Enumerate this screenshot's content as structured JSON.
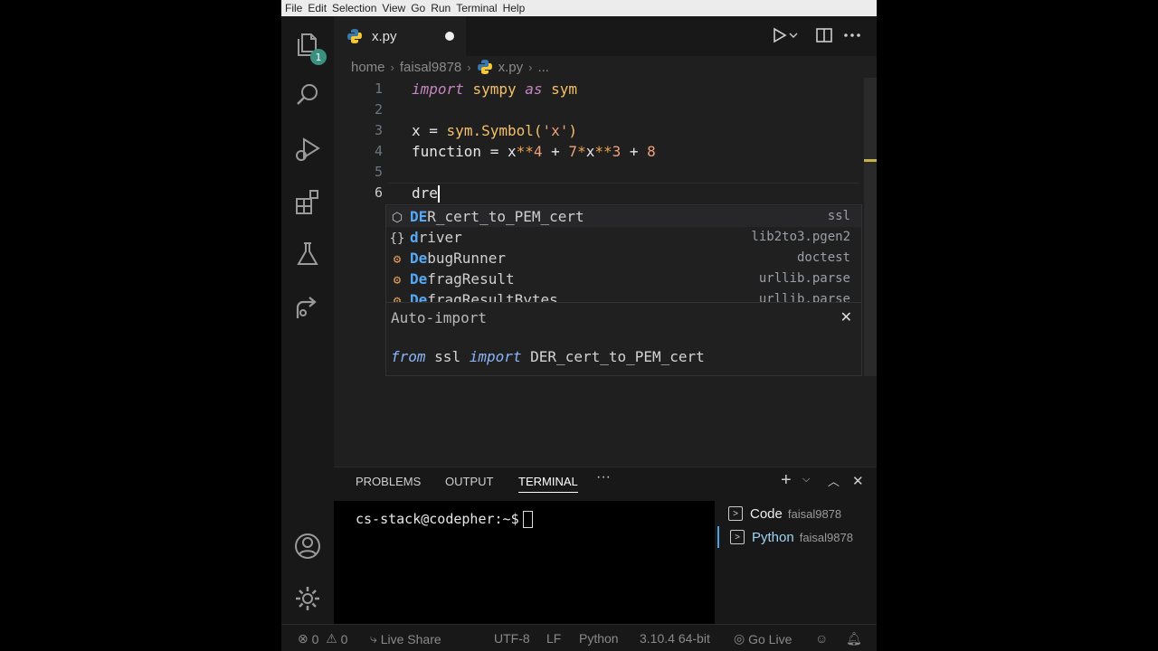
{
  "menu": [
    "File",
    "Edit",
    "Selection",
    "View",
    "Go",
    "Run",
    "Terminal",
    "Help"
  ],
  "activity": {
    "badge_count": "1"
  },
  "tab": {
    "filename": "x.py"
  },
  "breadcrumb": {
    "parts": [
      "home",
      "faisal9878",
      "x.py",
      "..."
    ]
  },
  "editor": {
    "line_numbers": [
      "1",
      "2",
      "3",
      "4",
      "5",
      "6"
    ],
    "line1": {
      "kw_import": "import",
      "module": "sympy",
      "kw_as": "as",
      "alias": "sym"
    },
    "line3": {
      "var": "x",
      "eq": " = ",
      "call": "sym.Symbol(",
      "str": "'x'",
      "close": ")"
    },
    "line4": {
      "var": "function",
      "eq": " = ",
      "a": "x",
      "op1": "**",
      "n1": "4",
      "p1": " + ",
      "n2": "7",
      "op2": "*",
      "b": "x",
      "op3": "**",
      "n3": "3",
      "p2": " + ",
      "n4": "8"
    },
    "line6": {
      "typed": "dre"
    }
  },
  "suggestions": [
    {
      "icon": "cube-icon",
      "match": "DE",
      "rest": "R_cert_to_PEM_cert",
      "detail": "ssl"
    },
    {
      "icon": "braces-icon",
      "match": "d",
      "rest": "river",
      "detail": "lib2to3.pgen2"
    },
    {
      "icon": "class-icon",
      "match": "De",
      "rest": "bugRunner",
      "detail": "doctest"
    },
    {
      "icon": "class-icon",
      "match": "De",
      "rest": "fragResult",
      "detail": "urllib.parse"
    },
    {
      "icon": "class-icon",
      "match": "De",
      "rest": "fragResultBytes",
      "detail": "urllib.parse"
    }
  ],
  "auto_import": {
    "title": "Auto-import",
    "kw_from": "from",
    "module": "ssl",
    "kw_import": "import",
    "name": "DER_cert_to_PEM_cert"
  },
  "panel": {
    "tabs": [
      "PROBLEMS",
      "OUTPUT",
      "TERMINAL"
    ],
    "active_tab": "TERMINAL",
    "prompt": "cs-stack@codepher:~$",
    "terminals": [
      {
        "name": "Code",
        "sub": "faisal9878"
      },
      {
        "name": "Python",
        "sub": "faisal9878"
      }
    ]
  },
  "status": {
    "errors": "0",
    "warnings": "0",
    "live_share": "Live Share",
    "encoding": "UTF-8",
    "eol": "LF",
    "language": "Python",
    "interpreter": "3.10.4 64-bit",
    "go_live": "Go Live"
  },
  "colors": {
    "accent": "#4aa3df",
    "badge": "#3b8f7e",
    "match": "#56a8f5"
  }
}
